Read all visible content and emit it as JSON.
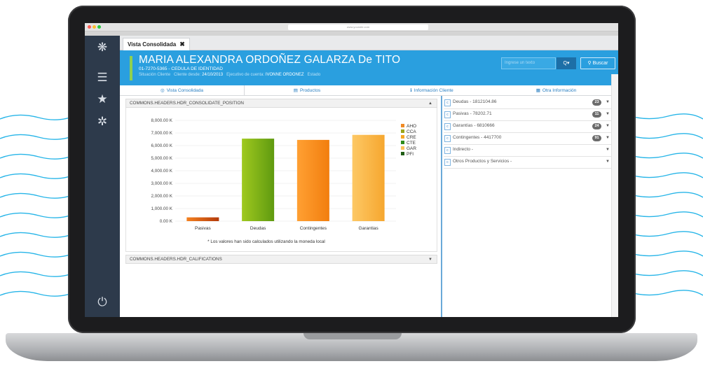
{
  "browser": {
    "address": "www.yoursite.com",
    "tab_strip": "www.yoursite.com"
  },
  "sidebar": {
    "icons": [
      "flower-logo-icon",
      "menu-icon",
      "star-icon",
      "gear-icon",
      "power-icon"
    ]
  },
  "tab": {
    "label": "Vista Consolidada",
    "close": "✖"
  },
  "header": {
    "name": "MARIA ALEXANDRA ORDOÑEZ GALARZA De TITO",
    "id_line": "01-7270-5365 - CEDULA DE IDENTIDAD",
    "situacion_label": "Situación Cliente",
    "cliente_desde_label": "Cliente desde:",
    "cliente_desde_value": "24/10/2013",
    "ejecutivo_label": "Ejecutivo de cuenta:",
    "ejecutivo_value": "IVONNE ORDONEZ",
    "estado_label": "Estado"
  },
  "search": {
    "placeholder": "Ingrese un texto",
    "button": "Q▾",
    "buscar": "Buscar"
  },
  "nav": {
    "tabs": [
      {
        "label": "Vista Consolidada",
        "icon": "target-icon"
      },
      {
        "label": "Productos",
        "icon": "stack-icon"
      },
      {
        "label": "Información Cliente",
        "icon": "info-icon"
      },
      {
        "label": "Otra Información",
        "icon": "grid-icon"
      }
    ]
  },
  "panels": {
    "consolidate": "COMMONS.HEADERS.HDR_CONSOLIDATE_POSITION",
    "califications": "COMMONS.HEADERS.HDR_CALIFICATIONS",
    "chart_note": "* Los valores han sido calculados utilizando la moneda local"
  },
  "right_list": [
    {
      "label": "Deudas - 1812104.86",
      "badge": "23"
    },
    {
      "label": "Pasivas - 78202.71",
      "badge": "11"
    },
    {
      "label": "Garantías - 6810666",
      "badge": "24"
    },
    {
      "label": "Contingentes - 4417700",
      "badge": "91"
    },
    {
      "label": "Indirecto -",
      "badge": ""
    },
    {
      "label": "Otros Productos y Servicios -",
      "badge": ""
    }
  ],
  "colors": {
    "header_blue": "#2a9fdf",
    "sidebar": "#2d3a4b",
    "accent_green": "#8fd14f"
  },
  "chart_data": {
    "type": "bar",
    "categories": [
      "Pasivas",
      "Deudas",
      "Contingentes",
      "Garantias"
    ],
    "series": [
      {
        "name": "AHO",
        "color": "#f08a24",
        "values": [
          300,
          0,
          0,
          0
        ]
      },
      {
        "name": "CCA",
        "color": "#9aa51a",
        "values": [
          0,
          0,
          0,
          0
        ]
      },
      {
        "name": "CRE",
        "color": "#f5a623",
        "values": [
          0,
          0,
          0,
          0
        ]
      },
      {
        "name": "CTE",
        "color": "#2e8b1a",
        "values": [
          0,
          6550,
          0,
          0
        ]
      },
      {
        "name": "GAR",
        "color": "#fbc15a",
        "values": [
          0,
          0,
          0,
          6850
        ]
      },
      {
        "name": "PFI",
        "color": "#1f5c14",
        "values": [
          0,
          0,
          0,
          0
        ]
      }
    ],
    "display_bars": [
      {
        "category": "Pasivas",
        "value": 300,
        "colors": [
          "#f5811f",
          "#b33a0a"
        ]
      },
      {
        "category": "Deudas",
        "value": 6550,
        "colors": [
          "#9fc91f",
          "#5f9a10"
        ]
      },
      {
        "category": "Contingentes",
        "value": 6450,
        "colors": [
          "#ffa033",
          "#f27e0e"
        ]
      },
      {
        "category": "Garantias",
        "value": 6850,
        "colors": [
          "#fdc865",
          "#f6a72f"
        ]
      }
    ],
    "yticks": [
      "0.00 K",
      "1,000.00 K",
      "2,000.00 K",
      "3,000.00 K",
      "4,000.00 K",
      "5,000.00 K",
      "6,000.00 K",
      "7,000.00 K",
      "8,000.00 K"
    ],
    "ylim": [
      0,
      8000
    ],
    "legend_position": "right",
    "grid": true
  }
}
